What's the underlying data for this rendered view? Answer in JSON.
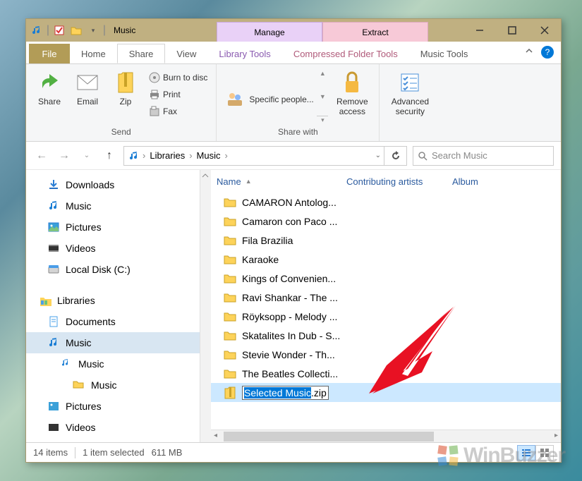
{
  "titlebar": {
    "title": "Music"
  },
  "contextTabs": {
    "manage": "Manage",
    "extract": "Extract"
  },
  "tabs": {
    "file": "File",
    "home": "Home",
    "share": "Share",
    "view": "View",
    "library": "Library Tools",
    "compressed": "Compressed Folder Tools",
    "music": "Music Tools"
  },
  "ribbon": {
    "send": {
      "label": "Send",
      "share": "Share",
      "email": "Email",
      "zip": "Zip",
      "burn": "Burn to disc",
      "print": "Print",
      "fax": "Fax"
    },
    "shareWith": {
      "label": "Share with",
      "specific": "Specific people...",
      "remove": "Remove access"
    },
    "advanced": "Advanced security"
  },
  "address": {
    "lib": "Libraries",
    "music": "Music",
    "searchPlaceholder": "Search Music"
  },
  "tree": {
    "downloads": "Downloads",
    "music": "Music",
    "pictures": "Pictures",
    "videos": "Videos",
    "localdisk": "Local Disk (C:)",
    "libraries": "Libraries",
    "docLib": "Documents",
    "musicLib": "Music",
    "musicSub1": "Music",
    "musicSub2": "Music",
    "picLib": "Pictures",
    "vidLib": "Videos"
  },
  "columns": {
    "name": "Name",
    "contrib": "Contributing artists",
    "album": "Album"
  },
  "files": [
    "CAMARON Antolog...",
    "Camaron con Paco ...",
    "Fila Brazilia",
    "Karaoke",
    "Kings of Convenien...",
    "Ravi Shankar - The ...",
    "Röyksopp - Melody ...",
    "Skatalites In Dub - S...",
    "Stevie Wonder - Th...",
    "The Beatles Collecti..."
  ],
  "rename": {
    "selected": "Selected Music",
    "ext": ".zip"
  },
  "status": {
    "items": "14 items",
    "selected": "1 item selected",
    "size": "611 MB"
  },
  "watermark": "WinBuzzer"
}
